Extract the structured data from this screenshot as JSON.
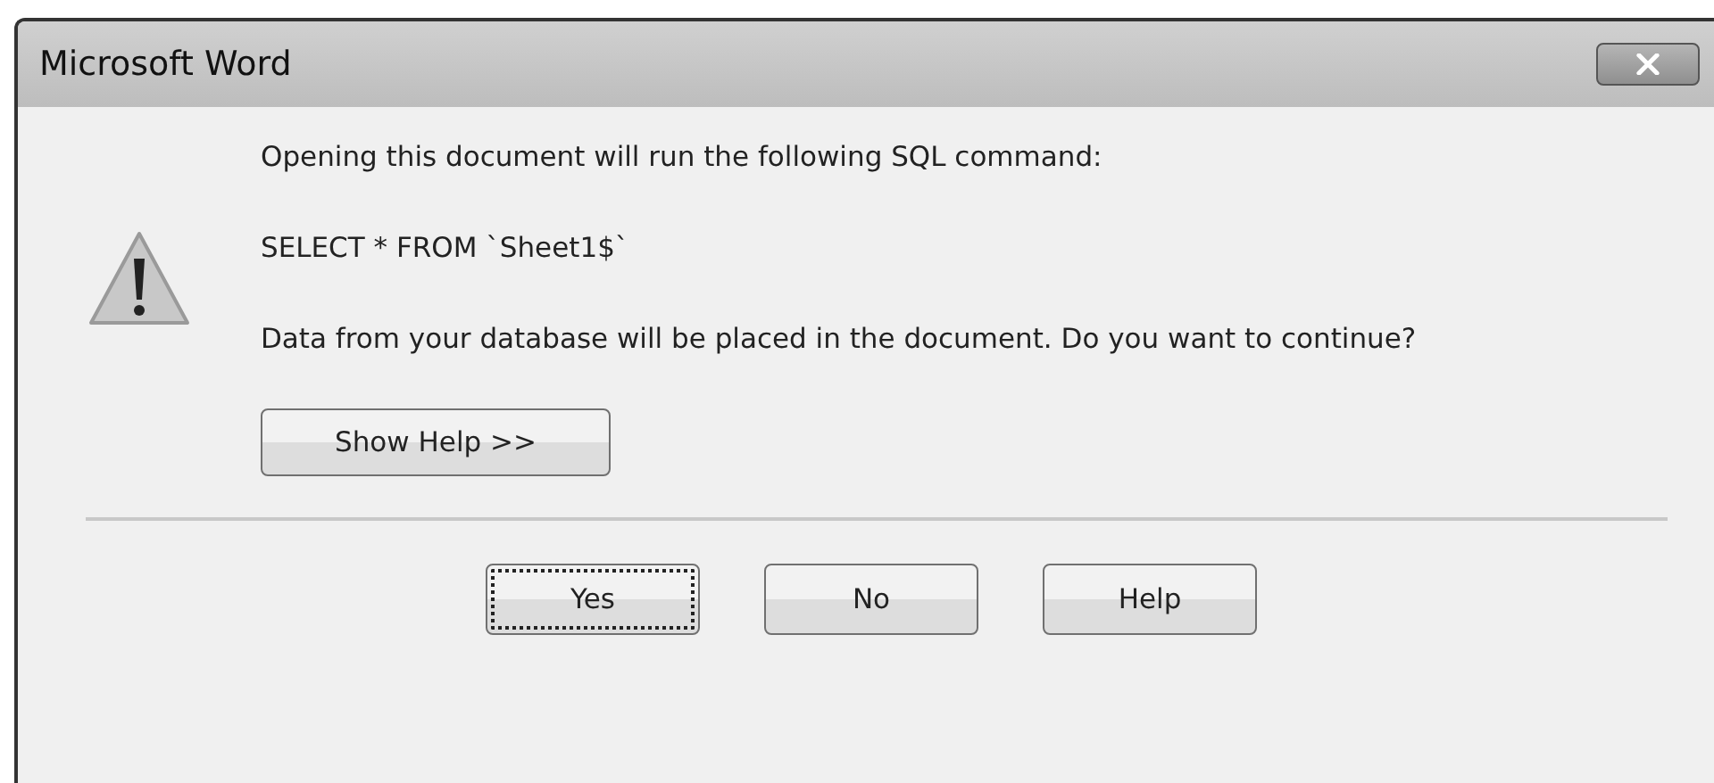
{
  "window": {
    "title": "Microsoft Word"
  },
  "message": {
    "lines": [
      "Opening this document will run the following SQL command:",
      "SELECT * FROM `Sheet1$`",
      "Data from your database will be placed in the document. Do you want to continue?"
    ]
  },
  "show_help_button": "Show Help >>",
  "buttons": [
    {
      "label": "Yes",
      "focused": true
    },
    {
      "label": "No",
      "focused": false
    },
    {
      "label": "Help",
      "focused": false
    }
  ]
}
